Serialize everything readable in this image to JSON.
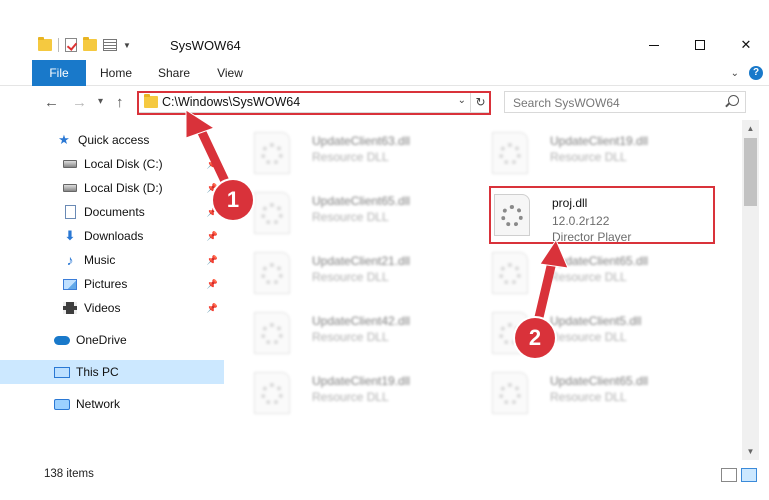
{
  "window": {
    "title": "SysWOW64",
    "minimize": "",
    "maximize": "",
    "close": "✕"
  },
  "ribbon": {
    "tabs": [
      "File",
      "Home",
      "Share",
      "View"
    ]
  },
  "nav": {
    "back": "←",
    "forward": "→",
    "dropdown": "▾",
    "up": "↑",
    "address": "C:\\Windows\\SysWOW64",
    "search_placeholder": "Search SysWOW64"
  },
  "sidebar": {
    "items": [
      {
        "label": "Quick access",
        "icon": "star-icon"
      },
      {
        "label": "Local Disk (C:)",
        "icon": "drive-icon",
        "pinned": true
      },
      {
        "label": "Local Disk (D:)",
        "icon": "drive-icon",
        "pinned": true
      },
      {
        "label": "Documents",
        "icon": "documents-icon",
        "pinned": true
      },
      {
        "label": "Downloads",
        "icon": "download-icon",
        "pinned": true
      },
      {
        "label": "Music",
        "icon": "music-icon",
        "pinned": true
      },
      {
        "label": "Pictures",
        "icon": "pictures-icon",
        "pinned": true
      },
      {
        "label": "Videos",
        "icon": "videos-icon",
        "pinned": true
      },
      {
        "label": "OneDrive",
        "icon": "onedrive-icon"
      },
      {
        "label": "This PC",
        "icon": "pc-icon",
        "selected": true
      },
      {
        "label": "Network",
        "icon": "network-icon"
      }
    ]
  },
  "files": [
    {
      "name": "UpdateClient63.dll",
      "type": "Resource DLL"
    },
    {
      "name": "UpdateClient19.dll",
      "type": "Resource DLL"
    },
    {
      "name": "UpdateClient65.dll",
      "type": "Resource DLL"
    },
    {
      "name": "proj.dll",
      "version": "12.0.2r122",
      "type": "Director Player"
    },
    {
      "name": "UpdateClient21.dll",
      "type": "Resource DLL"
    },
    {
      "name": "UpdateClient65.dll",
      "type": "Resource DLL"
    },
    {
      "name": "UpdateClient42.dll",
      "type": "Resource DLL"
    },
    {
      "name": "UpdateClient5.dll",
      "type": "Resource DLL"
    },
    {
      "name": "UpdateClient19.dll",
      "type": "Resource DLL"
    },
    {
      "name": "UpdateClient65.dll",
      "type": "Resource DLL"
    }
  ],
  "status": {
    "item_count": "138 items"
  },
  "annotations": {
    "step1": "1",
    "step2": "2",
    "color": "#d9323a"
  }
}
